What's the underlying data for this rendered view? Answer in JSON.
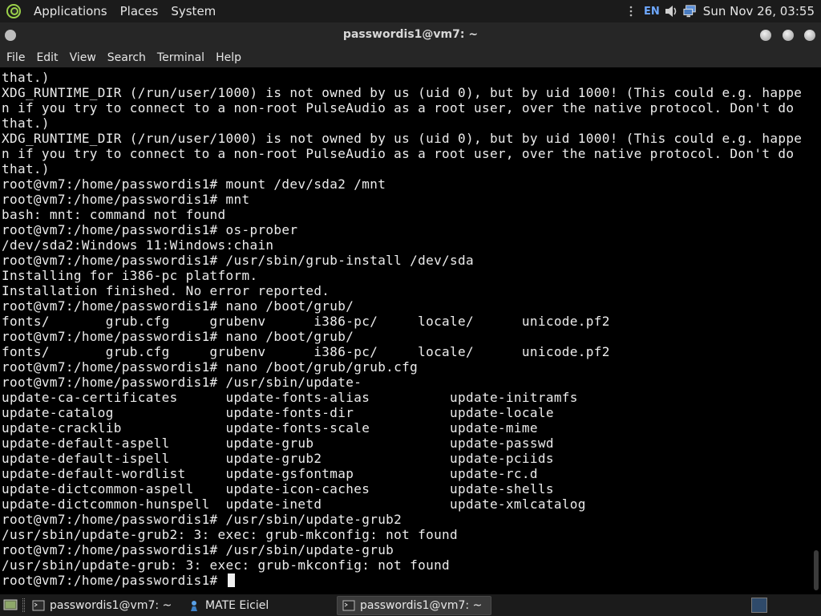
{
  "top_panel": {
    "menus": [
      "Applications",
      "Places",
      "System"
    ],
    "lang": "EN",
    "clock": "Sun Nov 26, 03:55"
  },
  "window": {
    "title": "passwordis1@vm7: ~"
  },
  "menubar": {
    "items": [
      "File",
      "Edit",
      "View",
      "Search",
      "Terminal",
      "Help"
    ]
  },
  "terminal": {
    "lines": [
      "that.)",
      "XDG_RUNTIME_DIR (/run/user/1000) is not owned by us (uid 0), but by uid 1000! (This could e.g. happe",
      "n if you try to connect to a non-root PulseAudio as a root user, over the native protocol. Don't do",
      "that.)",
      "XDG_RUNTIME_DIR (/run/user/1000) is not owned by us (uid 0), but by uid 1000! (This could e.g. happe",
      "n if you try to connect to a non-root PulseAudio as a root user, over the native protocol. Don't do",
      "that.)",
      "root@vm7:/home/passwordis1# mount /dev/sda2 /mnt",
      "root@vm7:/home/passwordis1# mnt",
      "bash: mnt: command not found",
      "root@vm7:/home/passwordis1# os-prober",
      "/dev/sda2:Windows 11:Windows:chain",
      "root@vm7:/home/passwordis1# /usr/sbin/grub-install /dev/sda",
      "Installing for i386-pc platform.",
      "Installation finished. No error reported.",
      "root@vm7:/home/passwordis1# nano /boot/grub/",
      "fonts/       grub.cfg     grubenv      i386-pc/     locale/      unicode.pf2",
      "root@vm7:/home/passwordis1# nano /boot/grub/",
      "fonts/       grub.cfg     grubenv      i386-pc/     locale/      unicode.pf2",
      "root@vm7:/home/passwordis1# nano /boot/grub/grub.cfg",
      "root@vm7:/home/passwordis1# /usr/sbin/update-",
      "update-ca-certificates      update-fonts-alias          update-initramfs",
      "update-catalog              update-fonts-dir            update-locale",
      "update-cracklib             update-fonts-scale          update-mime",
      "update-default-aspell       update-grub                 update-passwd",
      "update-default-ispell       update-grub2                update-pciids",
      "update-default-wordlist     update-gsfontmap            update-rc.d",
      "update-dictcommon-aspell    update-icon-caches          update-shells",
      "update-dictcommon-hunspell  update-inetd                update-xmlcatalog",
      "root@vm7:/home/passwordis1# /usr/sbin/update-grub2",
      "/usr/sbin/update-grub2: 3: exec: grub-mkconfig: not found",
      "root@vm7:/home/passwordis1# /usr/sbin/update-grub",
      "/usr/sbin/update-grub: 3: exec: grub-mkconfig: not found"
    ],
    "prompt": "root@vm7:/home/passwordis1# "
  },
  "taskbar": {
    "tasks": [
      "passwordis1@vm7: ~",
      "MATE Eiciel",
      "passwordis1@vm7: ~"
    ]
  },
  "icons": {
    "logo": "mate-logo-icon",
    "volume": "volume-icon",
    "network": "network-icon",
    "desktop": "show-desktop-icon",
    "terminal": "terminal-icon",
    "eiciel": "eiciel-icon",
    "workspace": "workspace-switcher-icon"
  },
  "colors": {
    "panel_bg": "#1b1b1b",
    "titlebar_bg": "#262626",
    "terminal_bg": "#000000",
    "terminal_fg": "#ececec",
    "lang_accent": "#6ea8ff"
  }
}
